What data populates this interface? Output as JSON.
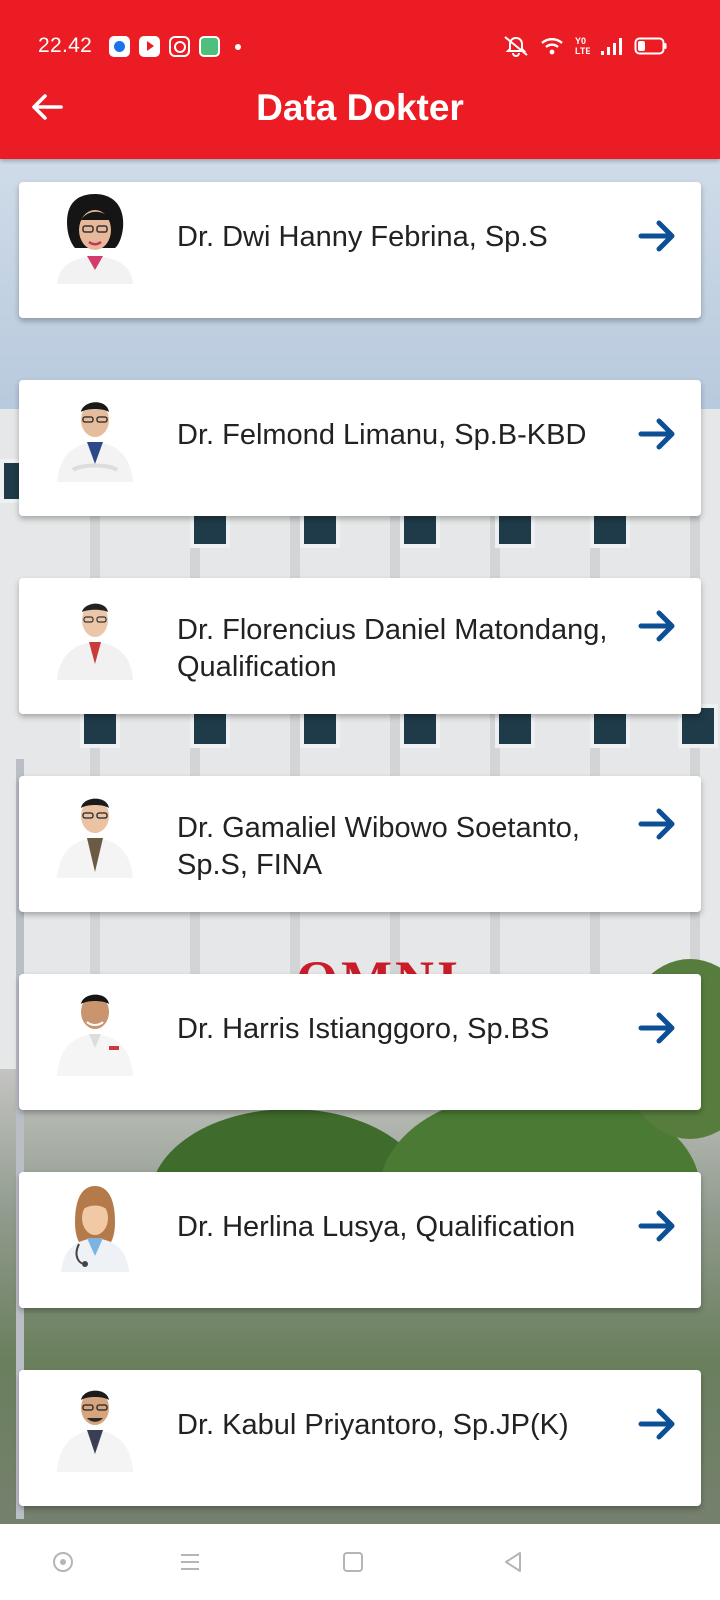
{
  "status_bar": {
    "time": "22.42",
    "notification_icons": [
      "messages-icon",
      "youtube-icon",
      "instagram-icon",
      "gallery-icon"
    ],
    "system_icons": [
      "mute-icon",
      "wifi-icon",
      "volte-icon",
      "signal-icon",
      "battery-icon"
    ]
  },
  "appbar": {
    "title": "Data Dokter",
    "back_icon": "arrow-left-icon"
  },
  "background": {
    "sign_text": "OMNI"
  },
  "doctors": [
    {
      "name": "Dr. Dwi Hanny Febrina, Sp.S",
      "avatar": "female-doctor-photo"
    },
    {
      "name": "Dr. Felmond Limanu, Sp.B-KBD",
      "avatar": "male-doctor-photo"
    },
    {
      "name": "Dr. Florencius Daniel Matondang, Qualification",
      "avatar": "male-doctor-photo"
    },
    {
      "name": "Dr. Gamaliel Wibowo Soetanto, Sp.S, FINA",
      "avatar": "male-doctor-photo"
    },
    {
      "name": "Dr. Harris Istianggoro, Sp.BS",
      "avatar": "male-doctor-photo"
    },
    {
      "name": "Dr. Herlina Lusya, Qualification",
      "avatar": "female-doctor-illustration"
    },
    {
      "name": "Dr. Kabul Priyantoro, Sp.JP(K)",
      "avatar": "male-doctor-photo"
    }
  ],
  "colors": {
    "header": "#ec1c24",
    "arrow": "#0d4f94",
    "card": "#ffffff"
  },
  "navbar": {
    "buttons": [
      "assistant-icon",
      "menu-icon",
      "home-icon",
      "back-icon"
    ]
  }
}
